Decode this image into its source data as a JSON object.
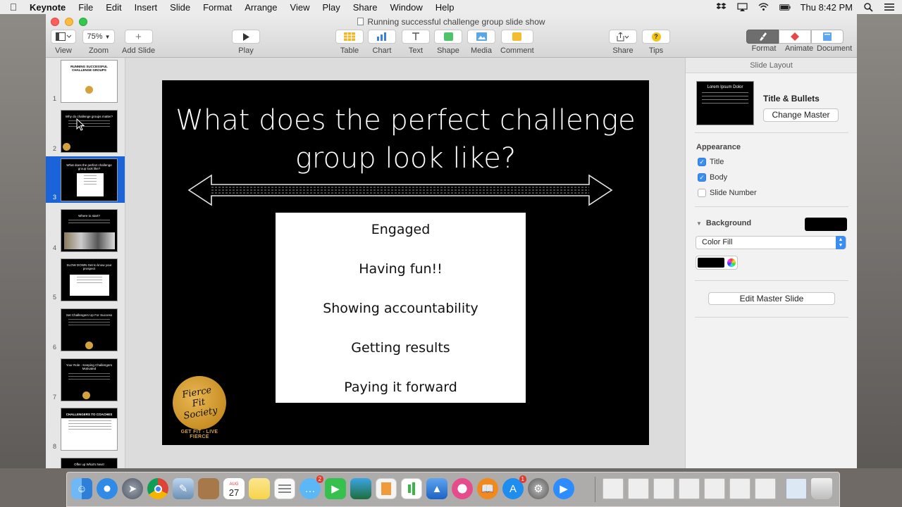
{
  "menubar": {
    "app_name": "Keynote",
    "items": [
      "File",
      "Edit",
      "Insert",
      "Slide",
      "Format",
      "Arrange",
      "View",
      "Play",
      "Share",
      "Window",
      "Help"
    ],
    "clock": "Thu 8:42 PM"
  },
  "window": {
    "title": "Running successful challenge group slide show"
  },
  "toolbar": {
    "view_label": "View",
    "zoom_value": "75%",
    "zoom_label": "Zoom",
    "add_slide_label": "Add Slide",
    "play_label": "Play",
    "table_label": "Table",
    "chart_label": "Chart",
    "text_label": "Text",
    "shape_label": "Shape",
    "media_label": "Media",
    "comment_label": "Comment",
    "share_label": "Share",
    "tips_label": "Tips",
    "format_label": "Format",
    "animate_label": "Animate",
    "document_label": "Document"
  },
  "navigator": {
    "selected_slide": 3,
    "slides": [
      {
        "num": "1",
        "title": "RUNNING SUCCESSFUL CHALLENGE GROUPS"
      },
      {
        "num": "2",
        "title": "Why do challenge groups matter?"
      },
      {
        "num": "3",
        "title": "What does the perfect challenge group look like?"
      },
      {
        "num": "4",
        "title": "Where to start?"
      },
      {
        "num": "5",
        "title": "SLOW DOWN Get to know your prospect"
      },
      {
        "num": "6",
        "title": "Set Challengers Up For Success"
      },
      {
        "num": "7",
        "title": "Your Role - Keeping Challengers Motivated"
      },
      {
        "num": "8",
        "title": "CHALLENGERS TO COACHES"
      },
      {
        "num": "",
        "title": "Offer up What's Next!"
      }
    ]
  },
  "slide": {
    "title": "What does the perfect challenge group look like?",
    "bullets": [
      "Engaged",
      "Having fun!!",
      "Showing accountability",
      "Getting results",
      "Paying it forward"
    ],
    "logo": {
      "brand": "Fierce Fit Society",
      "tagline": "GET FIT - LIVE FIERCE"
    }
  },
  "inspector": {
    "header": "Slide Layout",
    "layout_preview_text": "Lorem Ipsum Dolor",
    "layout_name": "Title & Bullets",
    "change_master_label": "Change Master",
    "appearance_label": "Appearance",
    "options": [
      {
        "label": "Title",
        "checked": true
      },
      {
        "label": "Body",
        "checked": true
      },
      {
        "label": "Slide Number",
        "checked": false
      }
    ],
    "background_label": "Background",
    "background_fill": "Color Fill",
    "background_color": "#000000",
    "edit_master_label": "Edit Master Slide"
  },
  "colors": {
    "selection_blue": "#1a63d9",
    "checkbox_blue": "#3a8ef1",
    "logo_gold": "#d4a23b"
  },
  "dock": {
    "calendar_day": "27",
    "calendar_month": "AUG",
    "messages_badge": "2",
    "appstore_badge": "1",
    "apps": [
      "finder-icon",
      "safari-icon",
      "launchpad-icon",
      "chrome-icon",
      "preview-icon",
      "notebook-icon",
      "calendar-icon",
      "notes-icon",
      "reminders-icon",
      "messages-icon",
      "facetime-icon",
      "photos-icon",
      "keynote-pages-icon",
      "numbers-icon",
      "keynote-icon",
      "itunes-icon",
      "ibooks-icon",
      "appstore-icon",
      "system-preferences-icon",
      "zoom-icon",
      "document-icon",
      "trash-icon"
    ]
  }
}
